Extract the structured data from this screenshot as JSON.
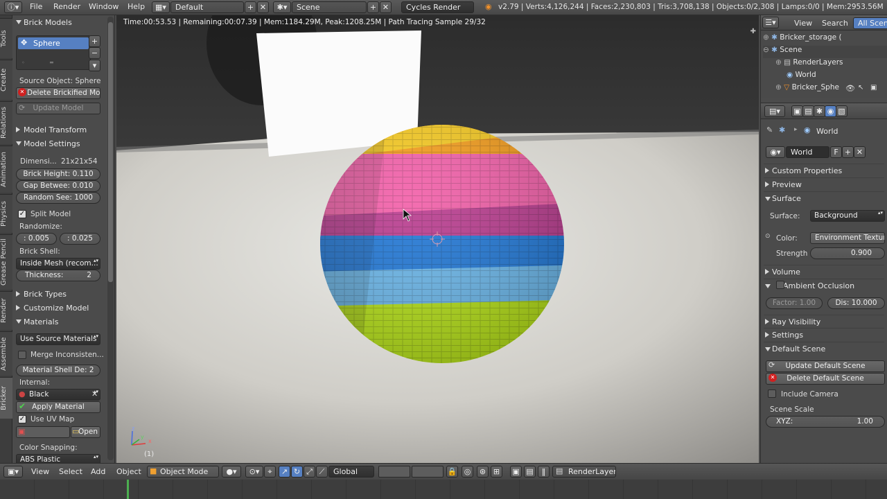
{
  "topbar": {
    "menus": [
      "File",
      "Render",
      "Window",
      "Help"
    ],
    "screen": "Default",
    "scene": "Scene",
    "engine": "Cycles Render",
    "stats": "v2.79 | Verts:4,126,244 | Faces:2,230,803 | Tris:3,708,138 | Objects:0/2,308 | Lamps:0/0 | Mem:2953.56M"
  },
  "side_tabs": [
    "Tools",
    "Create",
    "Relations",
    "Animation",
    "Physics",
    "Grease Pencil",
    "Render",
    "Assemble",
    "Bricker"
  ],
  "tool": {
    "brick_models": "Brick Models",
    "list_item": "Sphere",
    "source_object": "Source Object: Sphere",
    "delete_btn": "Delete Brickified Mo...",
    "update_btn": "Update Model",
    "model_transform": "Model Transform",
    "model_settings": "Model Settings",
    "dimensions_label": "Dimensi...",
    "dimensions_value": "21x21x54",
    "brick_height": "Brick Height:  0.110",
    "gap_between": "Gap Betwee: 0.010",
    "random_seed": "Random See:  1000",
    "split_model": "Split Model",
    "randomize_label": "Randomize:",
    "rand_a": ": 0.005",
    "rand_b": ": 0.025",
    "brick_shell_label": "Brick Shell:",
    "brick_shell_value": "Inside Mesh (recom...",
    "thickness": "Thickness:",
    "thickness_value": "2",
    "brick_types": "Brick Types",
    "customize_model": "Customize Model",
    "materials": "Materials",
    "use_source_materials": "Use Source Materials",
    "merge_inconsistent": "Merge Inconsisten...",
    "material_shell": "Material Shell De:  2",
    "internal_label": "Internal:",
    "internal_value": "Black",
    "apply_material": "Apply Material",
    "use_uv_map": "Use UV Map",
    "open_btn": "Open",
    "color_snapping_label": "Color Snapping:",
    "color_snapping_value": "ABS Plastic"
  },
  "viewport": {
    "info": "Time:00:53.53 | Remaining:00:07.39 | Mem:1184.29M, Peak:1208.25M | Path Tracing Sample 29/32",
    "frame": "(1)",
    "axis_x": "x",
    "axis_y": "y",
    "axis_z": "z"
  },
  "outliner": {
    "view": "View",
    "search": "Search",
    "all_scenes": "All Scene",
    "items": [
      "Bricker_storage (",
      "Scene",
      "RenderLayers",
      "World",
      "Bricker_Sphe"
    ]
  },
  "properties": {
    "context": "World",
    "world_field": "World",
    "f_btn": "F",
    "custom_properties": "Custom Properties",
    "preview": "Preview",
    "surface": "Surface",
    "surface_label": "Surface:",
    "surface_value": "Background",
    "color_label": "Color:",
    "color_value": "Environment Texture",
    "strength_label": "Strength",
    "strength_value": "0.900",
    "volume": "Volume",
    "ambient_occlusion": "Ambient Occlusion",
    "factor": "Factor: 1.00",
    "dist": "Dis: 10.000",
    "ray_visibility": "Ray Visibility",
    "settings": "Settings",
    "default_scene": "Default Scene",
    "update_default": "Update Default Scene",
    "delete_default": "Delete Default Scene",
    "include_camera": "Include Camera",
    "scene_scale": "Scene Scale",
    "xyz": "XYZ:",
    "xyz_value": "1.00"
  },
  "bottombar": {
    "menus": [
      "View",
      "Select",
      "Add",
      "Object"
    ],
    "mode": "Object Mode",
    "orientation": "Global",
    "render_layer": "RenderLayer"
  },
  "colors": {
    "accent": "#5680c2",
    "orange": "#f59a14",
    "pink": "#f25aa6",
    "blue": "#1a74d6",
    "lightblue": "#5fb2e6",
    "lime": "#b3e010"
  }
}
